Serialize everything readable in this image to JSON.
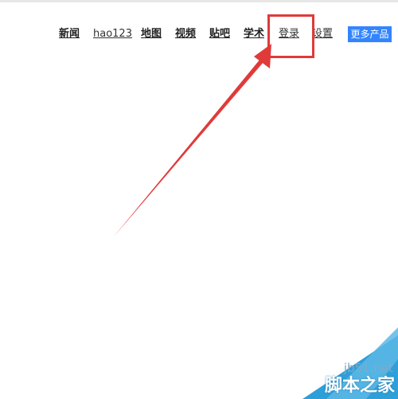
{
  "nav": {
    "items": [
      {
        "label": "新闻"
      },
      {
        "label": "hao123"
      },
      {
        "label": "地图"
      },
      {
        "label": "视频"
      },
      {
        "label": "贴吧"
      },
      {
        "label": "学术"
      },
      {
        "label": "登录"
      },
      {
        "label": "设置"
      }
    ],
    "more_button": "更多产品"
  },
  "annotation": {
    "highlight_color": "#e03a3a",
    "highlighted_item": "登录"
  },
  "watermark": {
    "domain": "jb51.net",
    "brand": "脚本之家"
  }
}
